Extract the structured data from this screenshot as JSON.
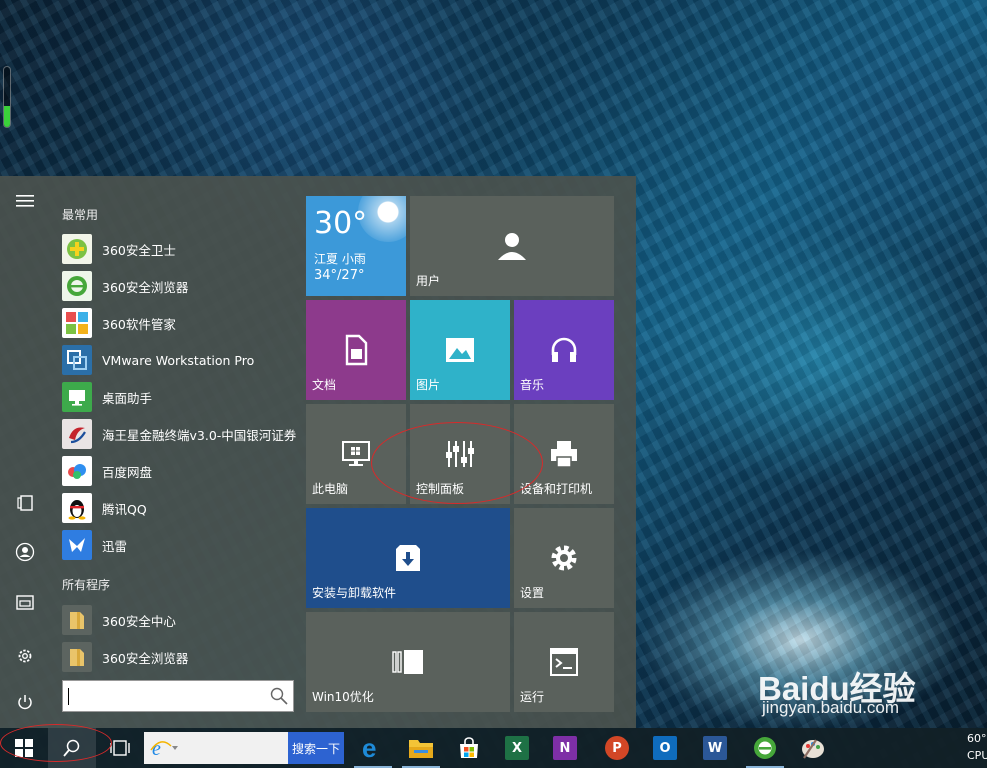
{
  "gauge": {
    "level": 0.35
  },
  "rail": {
    "items": [
      "menu-icon",
      "document-icon",
      "user-icon",
      "pictures-icon",
      "gear-icon",
      "power-icon"
    ]
  },
  "applist": {
    "section_frequent": "最常用",
    "frequent": [
      {
        "label": "360安全卫士",
        "icon": "shield-plus-icon",
        "color": "#5aa82a"
      },
      {
        "label": "360安全浏览器",
        "icon": "browser-e-icon",
        "color": "#46a73a"
      },
      {
        "label": "360软件管家",
        "icon": "colorful-squares-icon",
        "color": "#e94f4f"
      },
      {
        "label": "VMware Workstation Pro",
        "icon": "vmware-icon",
        "color": "#2b6fa8"
      },
      {
        "label": "桌面助手",
        "icon": "monitor-icon",
        "color": "#3daa4b"
      },
      {
        "label": "海王星金融终端v3.0-中国银河证券",
        "icon": "swirl-icon",
        "color": "#c4232c"
      },
      {
        "label": "百度网盘",
        "icon": "cloud-icon",
        "color": "#ffffff"
      },
      {
        "label": "腾讯QQ",
        "icon": "penguin-icon",
        "color": "#ffffff"
      },
      {
        "label": "迅雷",
        "icon": "bird-icon",
        "color": "#2f7de1"
      }
    ],
    "section_all": "所有程序",
    "all": [
      {
        "label": "360安全中心",
        "icon": "folder-icon",
        "color": "#e9c46a"
      },
      {
        "label": "360安全浏览器",
        "icon": "folder-icon",
        "color": "#e9c46a"
      }
    ]
  },
  "tiles": {
    "weather": {
      "temp": "30°",
      "location": "江夏 小雨",
      "range": "34°/27°",
      "color": "#3c99d9"
    },
    "user": {
      "label": "用户",
      "icon": "person-icon"
    },
    "documents": {
      "label": "文档",
      "icon": "document-icon",
      "color": "#8d3a8c"
    },
    "pictures": {
      "label": "图片",
      "icon": "picture-icon",
      "color": "#2fb2c9"
    },
    "music": {
      "label": "音乐",
      "icon": "headphones-icon",
      "color": "#6b3fbf"
    },
    "this_pc": {
      "label": "此电脑",
      "icon": "monitor-windows-icon"
    },
    "control_panel": {
      "label": "控制面板",
      "icon": "sliders-icon"
    },
    "devices": {
      "label": "设备和打印机",
      "icon": "printer-icon"
    },
    "uninstall": {
      "label": "安装与卸载软件",
      "icon": "install-box-icon",
      "color": "#1f4e8c"
    },
    "settings": {
      "label": "设置",
      "icon": "gear-icon"
    },
    "win10opt": {
      "label": "Win10优化",
      "icon": "panel-icon"
    },
    "run": {
      "label": "运行",
      "icon": "console-icon"
    }
  },
  "taskbar": {
    "search_button": "搜索一下",
    "apps": [
      "edge-icon",
      "file-explorer-icon",
      "store-icon",
      "excel-icon",
      "onenote-icon",
      "powerpoint-icon",
      "outlook-icon",
      "word-icon",
      "360-browser-icon",
      "paint-icon"
    ],
    "tray_lines": [
      "60°",
      "CPU温"
    ]
  },
  "watermark": {
    "main": "Baidu经验",
    "sub": "jingyan.baidu.com"
  },
  "colors": {
    "tile_gray": "#5a615c",
    "annotation": "#d62b2b"
  }
}
